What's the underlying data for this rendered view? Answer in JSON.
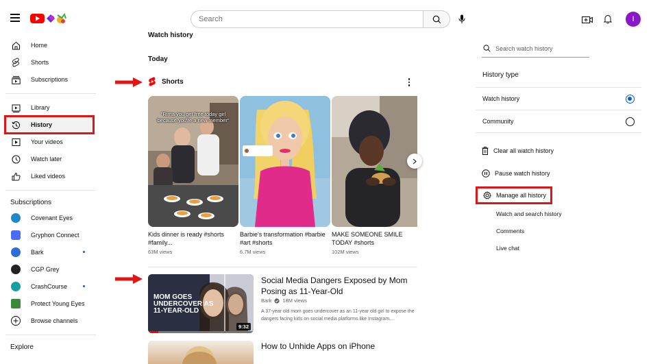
{
  "header": {
    "search_placeholder": "Search",
    "avatar_letter": "I",
    "icons": [
      "menu-icon",
      "youtube-logo",
      "search-icon",
      "mic-icon",
      "create-icon",
      "bell-icon"
    ]
  },
  "sidebar": {
    "main_items": [
      {
        "label": "Home",
        "icon": "home-icon"
      },
      {
        "label": "Shorts",
        "icon": "shorts-icon"
      },
      {
        "label": "Subscriptions",
        "icon": "subscriptions-icon"
      }
    ],
    "library_items": [
      {
        "label": "Library",
        "icon": "library-icon"
      },
      {
        "label": "History",
        "icon": "history-icon",
        "active": true
      },
      {
        "label": "Your videos",
        "icon": "your-videos-icon"
      },
      {
        "label": "Watch later",
        "icon": "clock-icon"
      },
      {
        "label": "Liked videos",
        "icon": "thumbs-up-icon"
      }
    ],
    "subscriptions_heading": "Subscriptions",
    "subscriptions": [
      {
        "label": "Covenant Eyes",
        "color": "#1e88c8",
        "new": false
      },
      {
        "label": "Gryphon Connect",
        "color": "#4a6cf0",
        "new": false
      },
      {
        "label": "Bark",
        "color": "#2a6fd8",
        "new": true
      },
      {
        "label": "CGP Grey",
        "color": "#222222",
        "new": false
      },
      {
        "label": "CrashCourse",
        "color": "#16a0a0",
        "new": true
      },
      {
        "label": "Protect Young Eyes",
        "color": "#3a8a3a",
        "new": false
      },
      {
        "label": "Browse channels",
        "color": "#ffffff",
        "new": false
      }
    ],
    "explore_heading": "Explore"
  },
  "main": {
    "page_title": "Watch history",
    "section_today": "Today",
    "shorts_label": "Shorts",
    "shorts": [
      {
        "title": "Kids dinner is ready #shorts #family...",
        "views": "63M views",
        "overlay": "\"Rima you get free today girl because you're a new member\""
      },
      {
        "title": "Barbie's transformation #barbie #art #shorts",
        "views": "6.7M views",
        "overlay": ""
      },
      {
        "title": "MAKE SOMEONE SMILE TODAY #shorts",
        "views": "102M views",
        "overlay": ""
      }
    ],
    "video": {
      "title": "Social Media Dangers Exposed by Mom Posing as 11-Year-Old",
      "channel": "Bark",
      "views": "18M views",
      "description": "A 37-year old mom goes undercover as an 11-year old girl to expose the dangers facing kids on social media platforms like Instagram,...",
      "duration": "9:32",
      "thumb_text": "MOM GOES UNDERCOVER AS 11-YEAR-OLD",
      "watched_fraction": 0.1
    },
    "video2": {
      "title": "How to Unhide Apps on iPhone"
    }
  },
  "right_panel": {
    "search_placeholder": "Search watch history",
    "history_type_heading": "History type",
    "history_types": [
      {
        "label": "Watch history",
        "selected": true
      },
      {
        "label": "Community",
        "selected": false
      }
    ],
    "actions": [
      {
        "label": "Clear all watch history",
        "icon": "trash-icon"
      },
      {
        "label": "Pause watch history",
        "icon": "pause-icon"
      },
      {
        "label": "Manage all history",
        "icon": "gear-icon"
      }
    ],
    "manage_links": [
      "Watch and search history",
      "Comments",
      "Live chat"
    ]
  },
  "annotations": {
    "highlight_color": "#e01515"
  }
}
